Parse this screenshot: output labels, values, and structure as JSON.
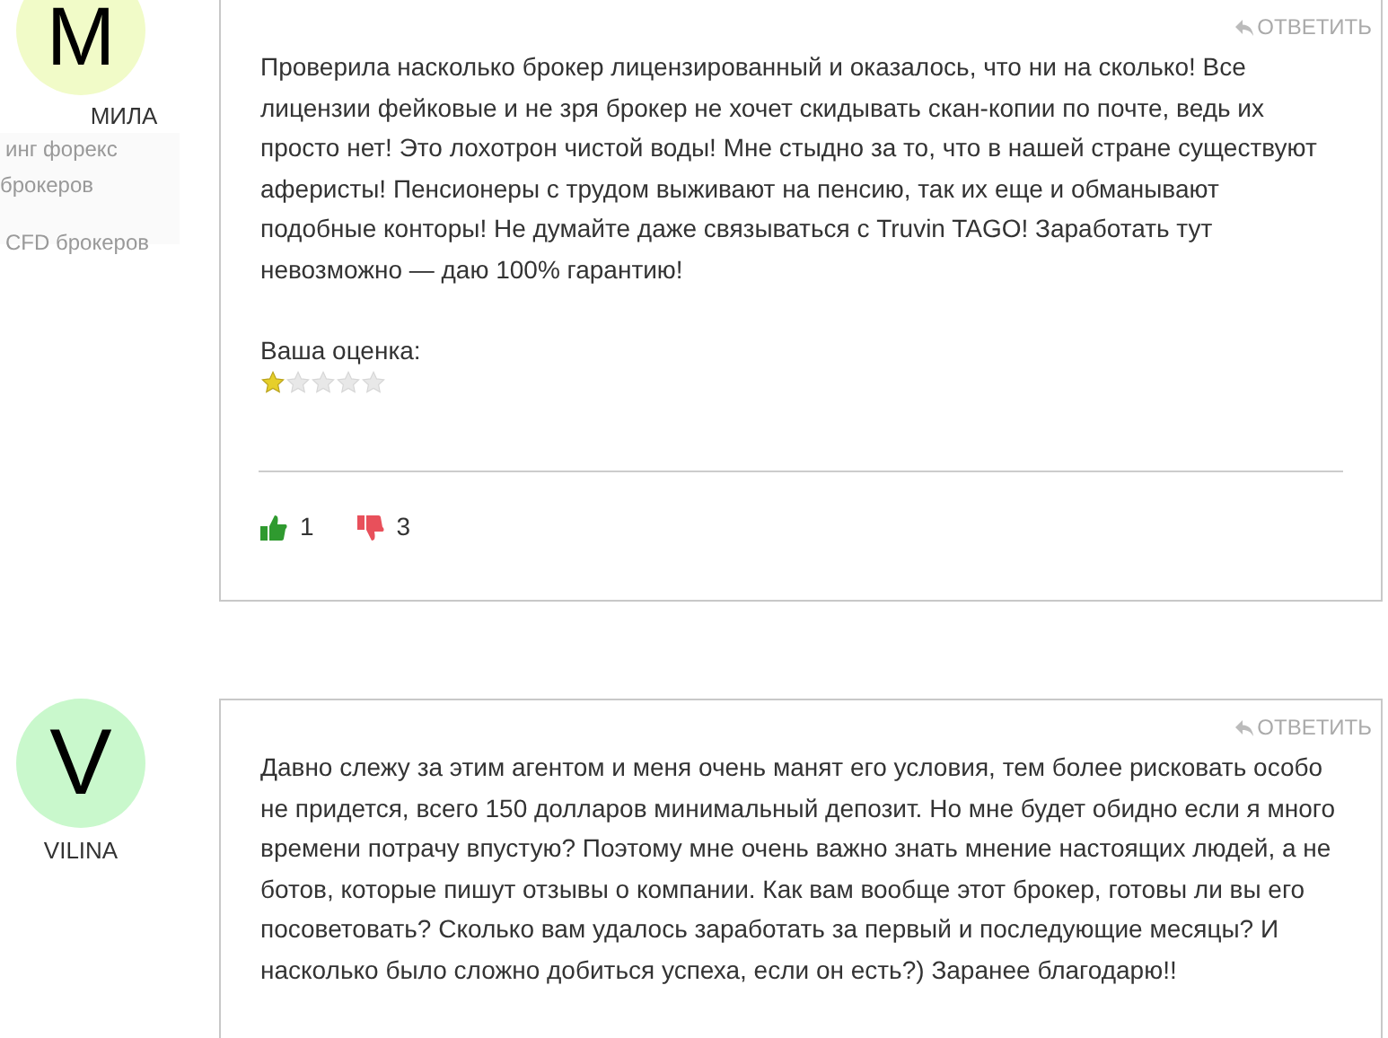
{
  "sidebar_faded": {
    "items": [
      "инг форекс",
      "брокеров",
      "CFD брокеров"
    ]
  },
  "comments": [
    {
      "avatar_letter": "M",
      "color": "#f1fbc8",
      "author": "МИЛА",
      "reply": "ОТВЕТИТЬ",
      "text": "Проверила насколько брокер лицензированный и оказалось, что ни на сколько! Все лицензии фейковые и не зря брокер не хочет скидывать скан-копии по почте, ведь их просто нет! Это лохотрон чистой воды! Мне стыдно за то, что в нашей стране существуют аферисты! Пенсионеры с трудом выживают на пенсию, так их еще и обманывают подобные конторы! Не думайте даже связываться с Truvin TAGO! Заработать тут невозможно — даю 100% гарантию!",
      "rating_label": "Ваша оценка:",
      "stars": 1,
      "likes": "1",
      "dislikes": "3"
    },
    {
      "avatar_letter": "V",
      "color": "#c9f8cc",
      "author": "VILINA",
      "reply": "ОТВЕТИТЬ",
      "text": "Давно слежу за этим агентом и меня очень манят его условия, тем более рисковать особо не придется, всего 150 долларов минимальный депозит. Но мне будет обидно если я много времени потрачу впустую? Поэтому мне очень важно знать мнение настоящих людей, а не ботов, которые пишут отзывы о компании. Как вам вообще этот брокер, готовы ли вы его посоветовать? Сколько вам удалось заработать за первый и последующие месяцы? И насколько было сложно добиться успеха, если он есть?) Заранее благодарю!!"
    }
  ]
}
